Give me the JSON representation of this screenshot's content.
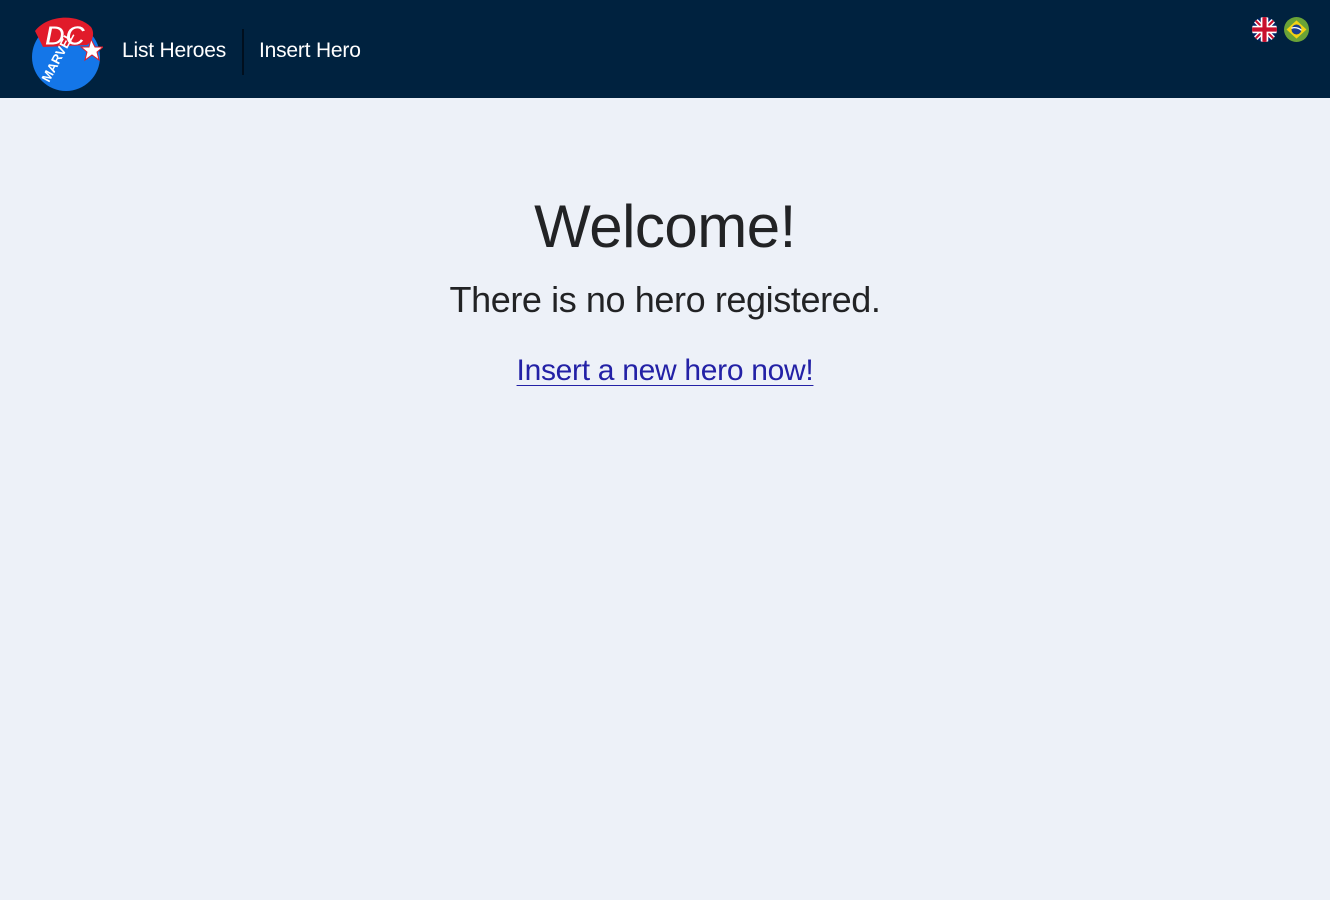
{
  "header": {
    "logo_text_top": "DC",
    "logo_text_bottom": "MARVEL",
    "nav": {
      "list_heroes": "List Heroes",
      "insert_hero": "Insert Hero"
    },
    "languages": [
      {
        "code": "en",
        "icon": "uk-flag-icon"
      },
      {
        "code": "pt-br",
        "icon": "brazil-flag-icon"
      }
    ]
  },
  "main": {
    "title": "Welcome!",
    "empty_message": "There is no hero registered.",
    "insert_link": "Insert a new hero now!"
  },
  "colors": {
    "header_bg": "#00223f",
    "page_bg": "#edf1f8",
    "link": "#2321a6",
    "text": "#222325"
  }
}
